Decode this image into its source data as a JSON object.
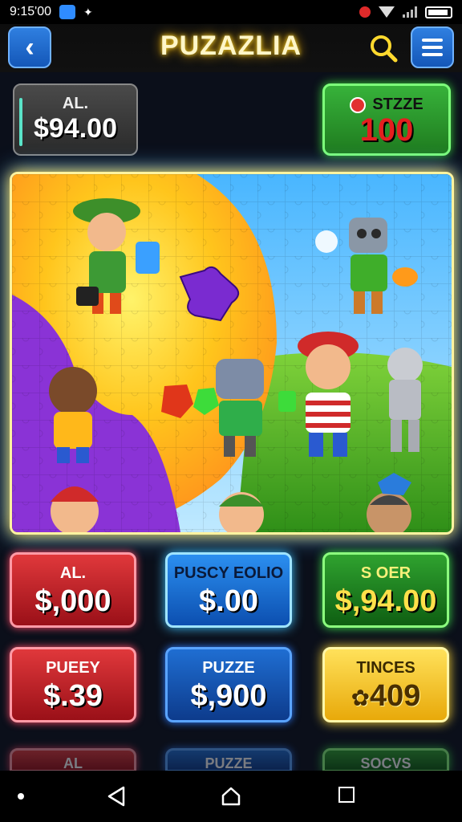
{
  "status_bar": {
    "time": "9:15",
    "extra": "'00",
    "icons": [
      "check-icon",
      "signal-icon",
      "alarm-icon",
      "wifi-icon",
      "battery-icon"
    ]
  },
  "header": {
    "title": "PUZAZLIA",
    "back_icon": "chevron-left-icon",
    "search_icon": "search-icon",
    "menu_icon": "menu-icon"
  },
  "stats": {
    "left": {
      "label": "AL.",
      "value": "$94.00"
    },
    "right": {
      "label": "STZZE",
      "value": "100"
    }
  },
  "tiles": [
    {
      "label": "AL.",
      "value": "$,000",
      "color": "#d82a34"
    },
    {
      "label": "PUSCY EOLIO",
      "value": "$.00",
      "color": "#2b8ff0"
    },
    {
      "label": "S OER",
      "value": "$,94.00",
      "color": "#2fa22f"
    },
    {
      "label": "PUEEY",
      "value": "$.39",
      "color": "#d82a34"
    },
    {
      "label": "PUZZE",
      "value": "$,900",
      "color": "#1f6ed2"
    },
    {
      "label": "TINCES",
      "value": "409",
      "color": "#ffd23a"
    }
  ],
  "peek_tiles": [
    {
      "label": "AL"
    },
    {
      "label": "PUZZE"
    },
    {
      "label": "SOCVS"
    }
  ],
  "nav": {
    "back": "nav-back-icon",
    "home": "nav-home-icon",
    "recent": "nav-recent-icon"
  }
}
